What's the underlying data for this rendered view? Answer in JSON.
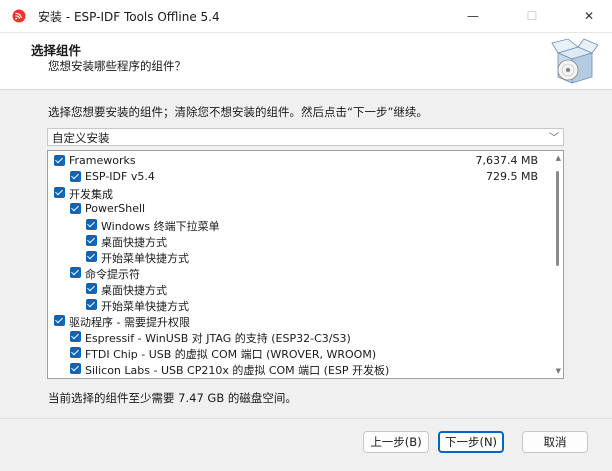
{
  "window": {
    "title": "安装 - ESP-IDF Tools Offline 5.4",
    "minimize_glyph": "—",
    "maximize_glyph": "☐",
    "close_glyph": "✕",
    "icon": "espressif-logo-icon"
  },
  "header": {
    "title": "选择组件",
    "subtitle": "您想安装哪些程序的组件？",
    "icon": "box-disc-icon"
  },
  "instruction": "选择您想要安装的组件；清除您不想安装的组件。然后点击“下一步”继续。",
  "install_type": {
    "selected": "自定义安装",
    "arrow": "﹀"
  },
  "components": [
    {
      "label": "Frameworks",
      "size": "7,637.4 MB",
      "checked": true
    },
    {
      "label": "ESP-IDF v5.4",
      "size": "729.5 MB",
      "checked": true
    },
    {
      "label": "开发集成",
      "size": "",
      "checked": true
    },
    {
      "label": "PowerShell",
      "size": "",
      "checked": true
    },
    {
      "label": "Windows 终端下拉菜单",
      "size": "",
      "checked": true
    },
    {
      "label": "桌面快捷方式",
      "size": "",
      "checked": true
    },
    {
      "label": "开始菜单快捷方式",
      "size": "",
      "checked": true
    },
    {
      "label": "命令提示符",
      "size": "",
      "checked": true
    },
    {
      "label": "桌面快捷方式",
      "size": "",
      "checked": true
    },
    {
      "label": "开始菜单快捷方式",
      "size": "",
      "checked": true
    },
    {
      "label": "驱动程序 - 需要提升权限",
      "size": "",
      "checked": true
    },
    {
      "label": "Espressif - WinUSB 对 JTAG 的支持 (ESP32-C3/S3)",
      "size": "",
      "checked": true
    },
    {
      "label": "FTDI Chip - USB 的虚拟 COM 端口 (WROVER, WROOM)",
      "size": "",
      "checked": true
    },
    {
      "label": "Silicon Labs - USB CP210x 的虚拟 COM 端口 (ESP 开发板)",
      "size": "",
      "checked": true
    }
  ],
  "space_required": "当前选择的组件至少需要 7.47 GB 的磁盘空间。",
  "buttons": {
    "back": "上一步(B)",
    "next": "下一步(N)",
    "cancel": "取消"
  },
  "colors": {
    "accent": "#0067c0",
    "logo": "#e8362d"
  }
}
